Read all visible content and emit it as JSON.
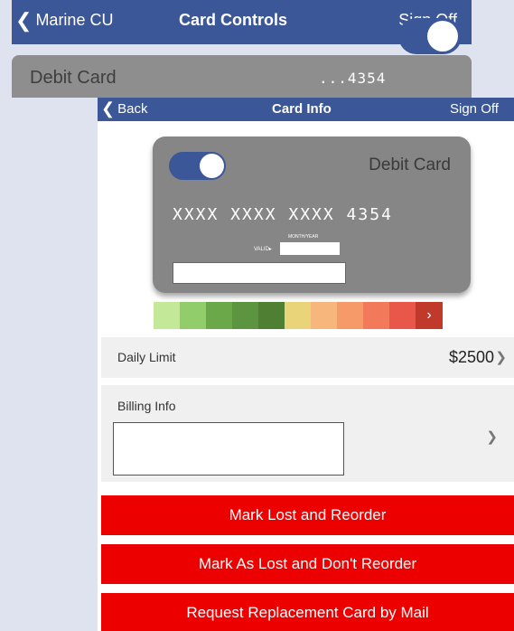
{
  "back_screen": {
    "nav": {
      "back_label": "Marine CU",
      "title": "Card Controls",
      "right_label": "Sign Off"
    },
    "card_row": {
      "label": "Debit Card",
      "number": "...4354"
    }
  },
  "front_screen": {
    "nav": {
      "back_label": "Back",
      "title": "Card Info",
      "right_label": "Sign Off"
    },
    "card": {
      "type": "Debit Card",
      "number": "XXXX XXXX XXXX 4354",
      "expiry_caption": "MONTH/YEAR",
      "valid_label": "VALID▸"
    },
    "risk_colors": [
      "#c3e897",
      "#91cd6b",
      "#6aa84a",
      "#5c9440",
      "#4e7f33",
      "#ead47a",
      "#f7b67b",
      "#f79a6a",
      "#f2795a",
      "#e9564a"
    ],
    "daily_limit": {
      "label": "Daily Limit",
      "value": "$2500"
    },
    "billing": {
      "label": "Billing Info"
    },
    "buttons": {
      "mark_lost_reorder": "Mark Lost and Reorder",
      "mark_lost_no_reorder": "Mark As Lost and Don't Reorder",
      "request_replacement": "Request Replacement Card by Mail"
    }
  },
  "colors": {
    "nav_bg": "#3b5797",
    "action_red": "#ec0000",
    "card_gray": "#868686"
  }
}
